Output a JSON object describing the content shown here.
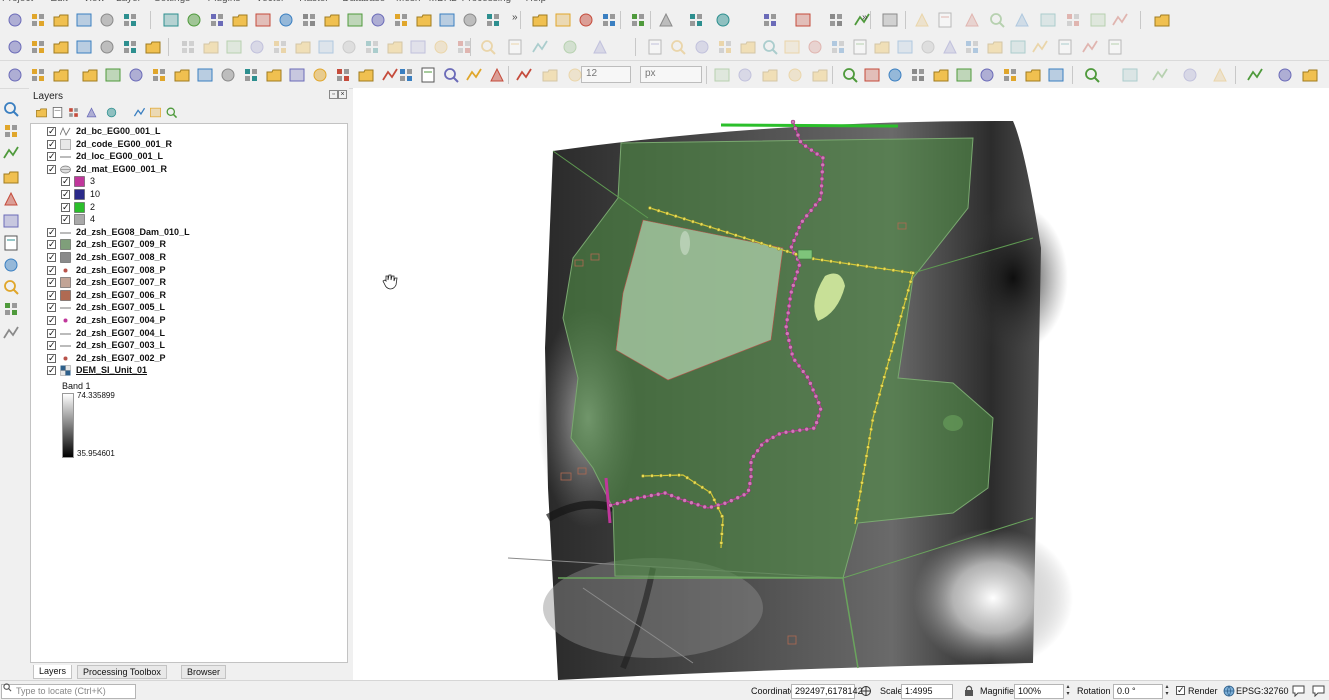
{
  "menu": [
    "Project",
    "Edit",
    "View",
    "Layer",
    "Settings",
    "Plugins",
    "Vector",
    "Raster",
    "Database",
    "Mesh",
    "MDAL",
    "Processing",
    "Help"
  ],
  "layers_panel": {
    "title": "Layers",
    "tree": [
      {
        "label": "2d_bc_EG00_001_L",
        "checked": true,
        "expand": "▸",
        "indent": 0,
        "symbol": "line-multi-icon"
      },
      {
        "label": "2d_code_EG00_001_R",
        "checked": true,
        "expand": "",
        "indent": 0,
        "symbol": "polygon-empty-icon"
      },
      {
        "label": "2d_loc_EG00_001_L",
        "checked": true,
        "expand": "",
        "indent": 0,
        "symbol": "line-icon"
      },
      {
        "label": "2d_mat_EG00_001_R",
        "checked": true,
        "expand": "▾",
        "indent": 0,
        "symbol": "polygon-categorized-icon"
      },
      {
        "label": "3",
        "checked": true,
        "expand": "",
        "indent": 1,
        "symbol": "swatch",
        "color": "#c0379b",
        "plain": true
      },
      {
        "label": "10",
        "checked": true,
        "expand": "",
        "indent": 1,
        "symbol": "swatch",
        "color": "#2b2a8a",
        "plain": true
      },
      {
        "label": "2",
        "checked": true,
        "expand": "",
        "indent": 1,
        "symbol": "swatch",
        "color": "#2bbf2b",
        "plain": true
      },
      {
        "label": "4",
        "checked": true,
        "expand": "",
        "indent": 1,
        "symbol": "swatch",
        "color": "#a9a9a9",
        "plain": true
      },
      {
        "label": "2d_zsh_EG08_Dam_010_L",
        "checked": true,
        "expand": "",
        "indent": 0,
        "symbol": "line-icon"
      },
      {
        "label": "2d_zsh_EG07_009_R",
        "checked": true,
        "expand": "",
        "indent": 0,
        "symbol": "swatch",
        "color": "#7f9f7a"
      },
      {
        "label": "2d_zsh_EG07_008_R",
        "checked": true,
        "expand": "",
        "indent": 0,
        "symbol": "swatch",
        "color": "#8a8a8a"
      },
      {
        "label": "2d_zsh_EG07_008_P",
        "checked": true,
        "expand": "",
        "indent": 0,
        "symbol": "point-icon",
        "color": "#b8524a"
      },
      {
        "label": "2d_zsh_EG07_007_R",
        "checked": true,
        "expand": "",
        "indent": 0,
        "symbol": "swatch",
        "color": "#c2a496"
      },
      {
        "label": "2d_zsh_EG07_006_R",
        "checked": true,
        "expand": "",
        "indent": 0,
        "symbol": "swatch",
        "color": "#b06a52"
      },
      {
        "label": "2d_zsh_EG07_005_L",
        "checked": true,
        "expand": "",
        "indent": 0,
        "symbol": "line-icon"
      },
      {
        "label": "2d_zsh_EG07_004_P",
        "checked": true,
        "expand": "",
        "indent": 0,
        "symbol": "point-icon",
        "color": "#c0379b"
      },
      {
        "label": "2d_zsh_EG07_004_L",
        "checked": true,
        "expand": "",
        "indent": 0,
        "symbol": "line-icon"
      },
      {
        "label": "2d_zsh_EG07_003_L",
        "checked": true,
        "expand": "",
        "indent": 0,
        "symbol": "line-icon"
      },
      {
        "label": "2d_zsh_EG07_002_P",
        "checked": true,
        "expand": "",
        "indent": 0,
        "symbol": "point-icon",
        "color": "#b8524a"
      },
      {
        "label": "DEM_SI_Unit_01",
        "checked": true,
        "expand": "▾",
        "indent": 0,
        "symbol": "raster-icon",
        "underline": true
      }
    ],
    "band_label": "Band 1",
    "ramp_max": "74.335899",
    "ramp_min": "35.954601",
    "tabs": [
      "Layers",
      "Processing Toolbox",
      "Browser"
    ],
    "active_tab": "Layers"
  },
  "toolbar3": {
    "size_value": "12",
    "size_unit": "px"
  },
  "statusbar": {
    "locator_placeholder": "Type to locate (Ctrl+K)",
    "coordinate_label": "Coordinate",
    "coordinate_value": "292497,6178142",
    "scale_label": "Scale",
    "scale_value": "1:4995",
    "magnifier_label": "Magnifier",
    "magnifier_value": "100%",
    "rotation_label": "Rotation",
    "rotation_value": "0.0 °",
    "render_label": "Render",
    "render_checked": true,
    "crs_label": "EPSG:32760"
  },
  "colors": {
    "accent_green": "#2bbf2b",
    "pipe_magenta": "#c0379b",
    "channel_yellow": "#d4c93a",
    "zone_green": "#5a9a4a",
    "zone_light": "#9fc39a"
  }
}
